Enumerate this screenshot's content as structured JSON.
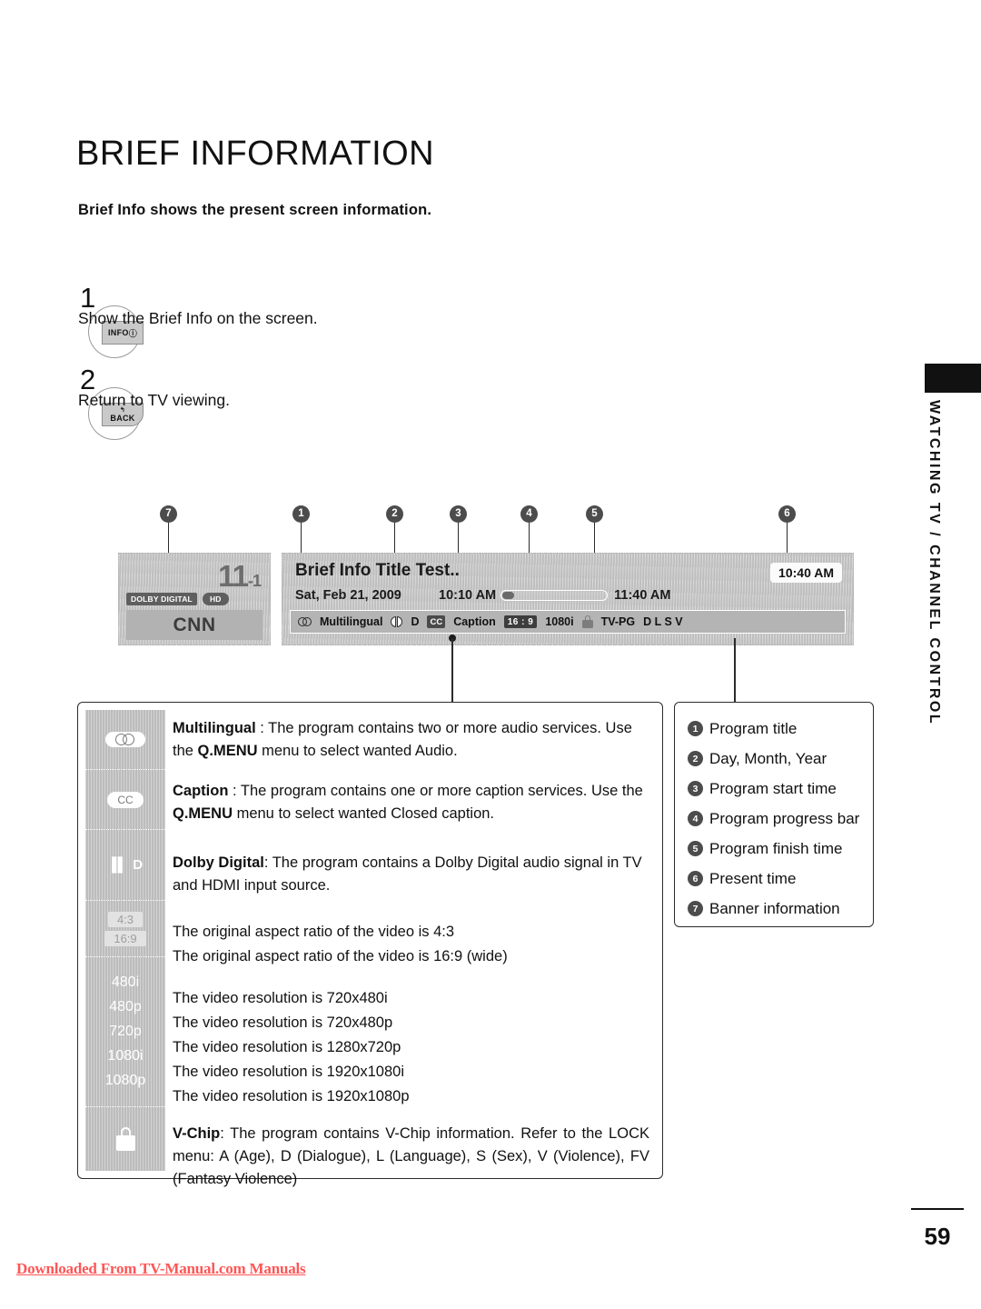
{
  "page": {
    "title": "BRIEF INFORMATION",
    "subtitle": "Brief Info shows the present screen information.",
    "number": "59",
    "download_note": "Downloaded From TV-Manual.com Manuals",
    "sidebar_label": "WATCHING TV / CHANNEL CONTROL"
  },
  "steps": [
    {
      "num": "1",
      "key": "INFO",
      "key_suffix": "ⓘ",
      "text": "Show the Brief Info on the screen."
    },
    {
      "num": "2",
      "key": "BACK",
      "key_arrow": "↰",
      "text": "Return to TV viewing."
    }
  ],
  "banner": {
    "channel_number": "11",
    "channel_sub": "-1",
    "tag_dolby": "DOLBY DIGITAL",
    "tag_hd": "HD",
    "channel_name": "CNN",
    "program_title": "Brief Info Title Test..",
    "date": "Sat, Feb 21, 2009",
    "start_time": "10:10 AM",
    "finish_time": "11:40 AM",
    "present_time": "10:40 AM",
    "progress_percent": 11,
    "info_strip": {
      "multilingual": "Multilingual",
      "dolby_letter": "D",
      "cc_badge": "CC",
      "caption": "Caption",
      "ratio_badge": "16 : 9",
      "resolution": "1080i",
      "rating": "TV-PG",
      "rating_flags": "D L S V"
    }
  },
  "callouts": [
    {
      "id": "7",
      "label": "Banner information"
    },
    {
      "id": "1",
      "label": "Program title"
    },
    {
      "id": "2",
      "label": "Day, Month, Year"
    },
    {
      "id": "3",
      "label": "Program start time"
    },
    {
      "id": "4",
      "label": "Program progress bar"
    },
    {
      "id": "5",
      "label": "Program finish time"
    },
    {
      "id": "6",
      "label": "Present time"
    }
  ],
  "number_legend": [
    {
      "num": "1",
      "text": "Program title"
    },
    {
      "num": "2",
      "text": "Day, Month, Year"
    },
    {
      "num": "3",
      "text": "Program start time"
    },
    {
      "num": "4",
      "text": "Program progress bar"
    },
    {
      "num": "5",
      "text": "Program finish time"
    },
    {
      "num": "6",
      "text": "Present time"
    },
    {
      "num": "7",
      "text": "Banner information"
    }
  ],
  "legend": {
    "multilingual": {
      "term": "Multilingual",
      "body_1": " : The program contains two or more audio services. Use the ",
      "emph": "Q.MENU",
      "body_2": " menu to select wanted Audio."
    },
    "caption": {
      "term": "Caption",
      "body_1": " : The program contains one or more caption services. Use the ",
      "emph": "Q.MENU",
      "body_2": " menu to select wanted Closed caption."
    },
    "dolby": {
      "term": "Dolby Digital",
      "body": ": The program contains a Dolby Digital audio signal in TV and HDMI input source.",
      "icon_text": "▐▌ D"
    },
    "ratios": [
      {
        "chip": "4:3",
        "text": "The original aspect ratio of the video is 4:3"
      },
      {
        "chip": "16:9",
        "text": "The original aspect ratio of the video is 16:9 (wide)"
      }
    ],
    "resolutions": [
      {
        "chip": "480i",
        "text": "The video resolution is 720x480i"
      },
      {
        "chip": "480p",
        "text": "The video resolution is 720x480p"
      },
      {
        "chip": "720p",
        "text": "The video resolution is 1280x720p"
      },
      {
        "chip": "1080i",
        "text": "The video resolution is 1920x1080i"
      },
      {
        "chip": "1080p",
        "text": "The video resolution is 1920x1080p"
      }
    ],
    "vchip": {
      "term": "V-Chip",
      "body": ": The program contains V-Chip information. Refer to the LOCK menu: A (Age), D (Dialogue), L (Language), S (Sex), V (Violence), FV (Fantasy Violence)"
    }
  }
}
